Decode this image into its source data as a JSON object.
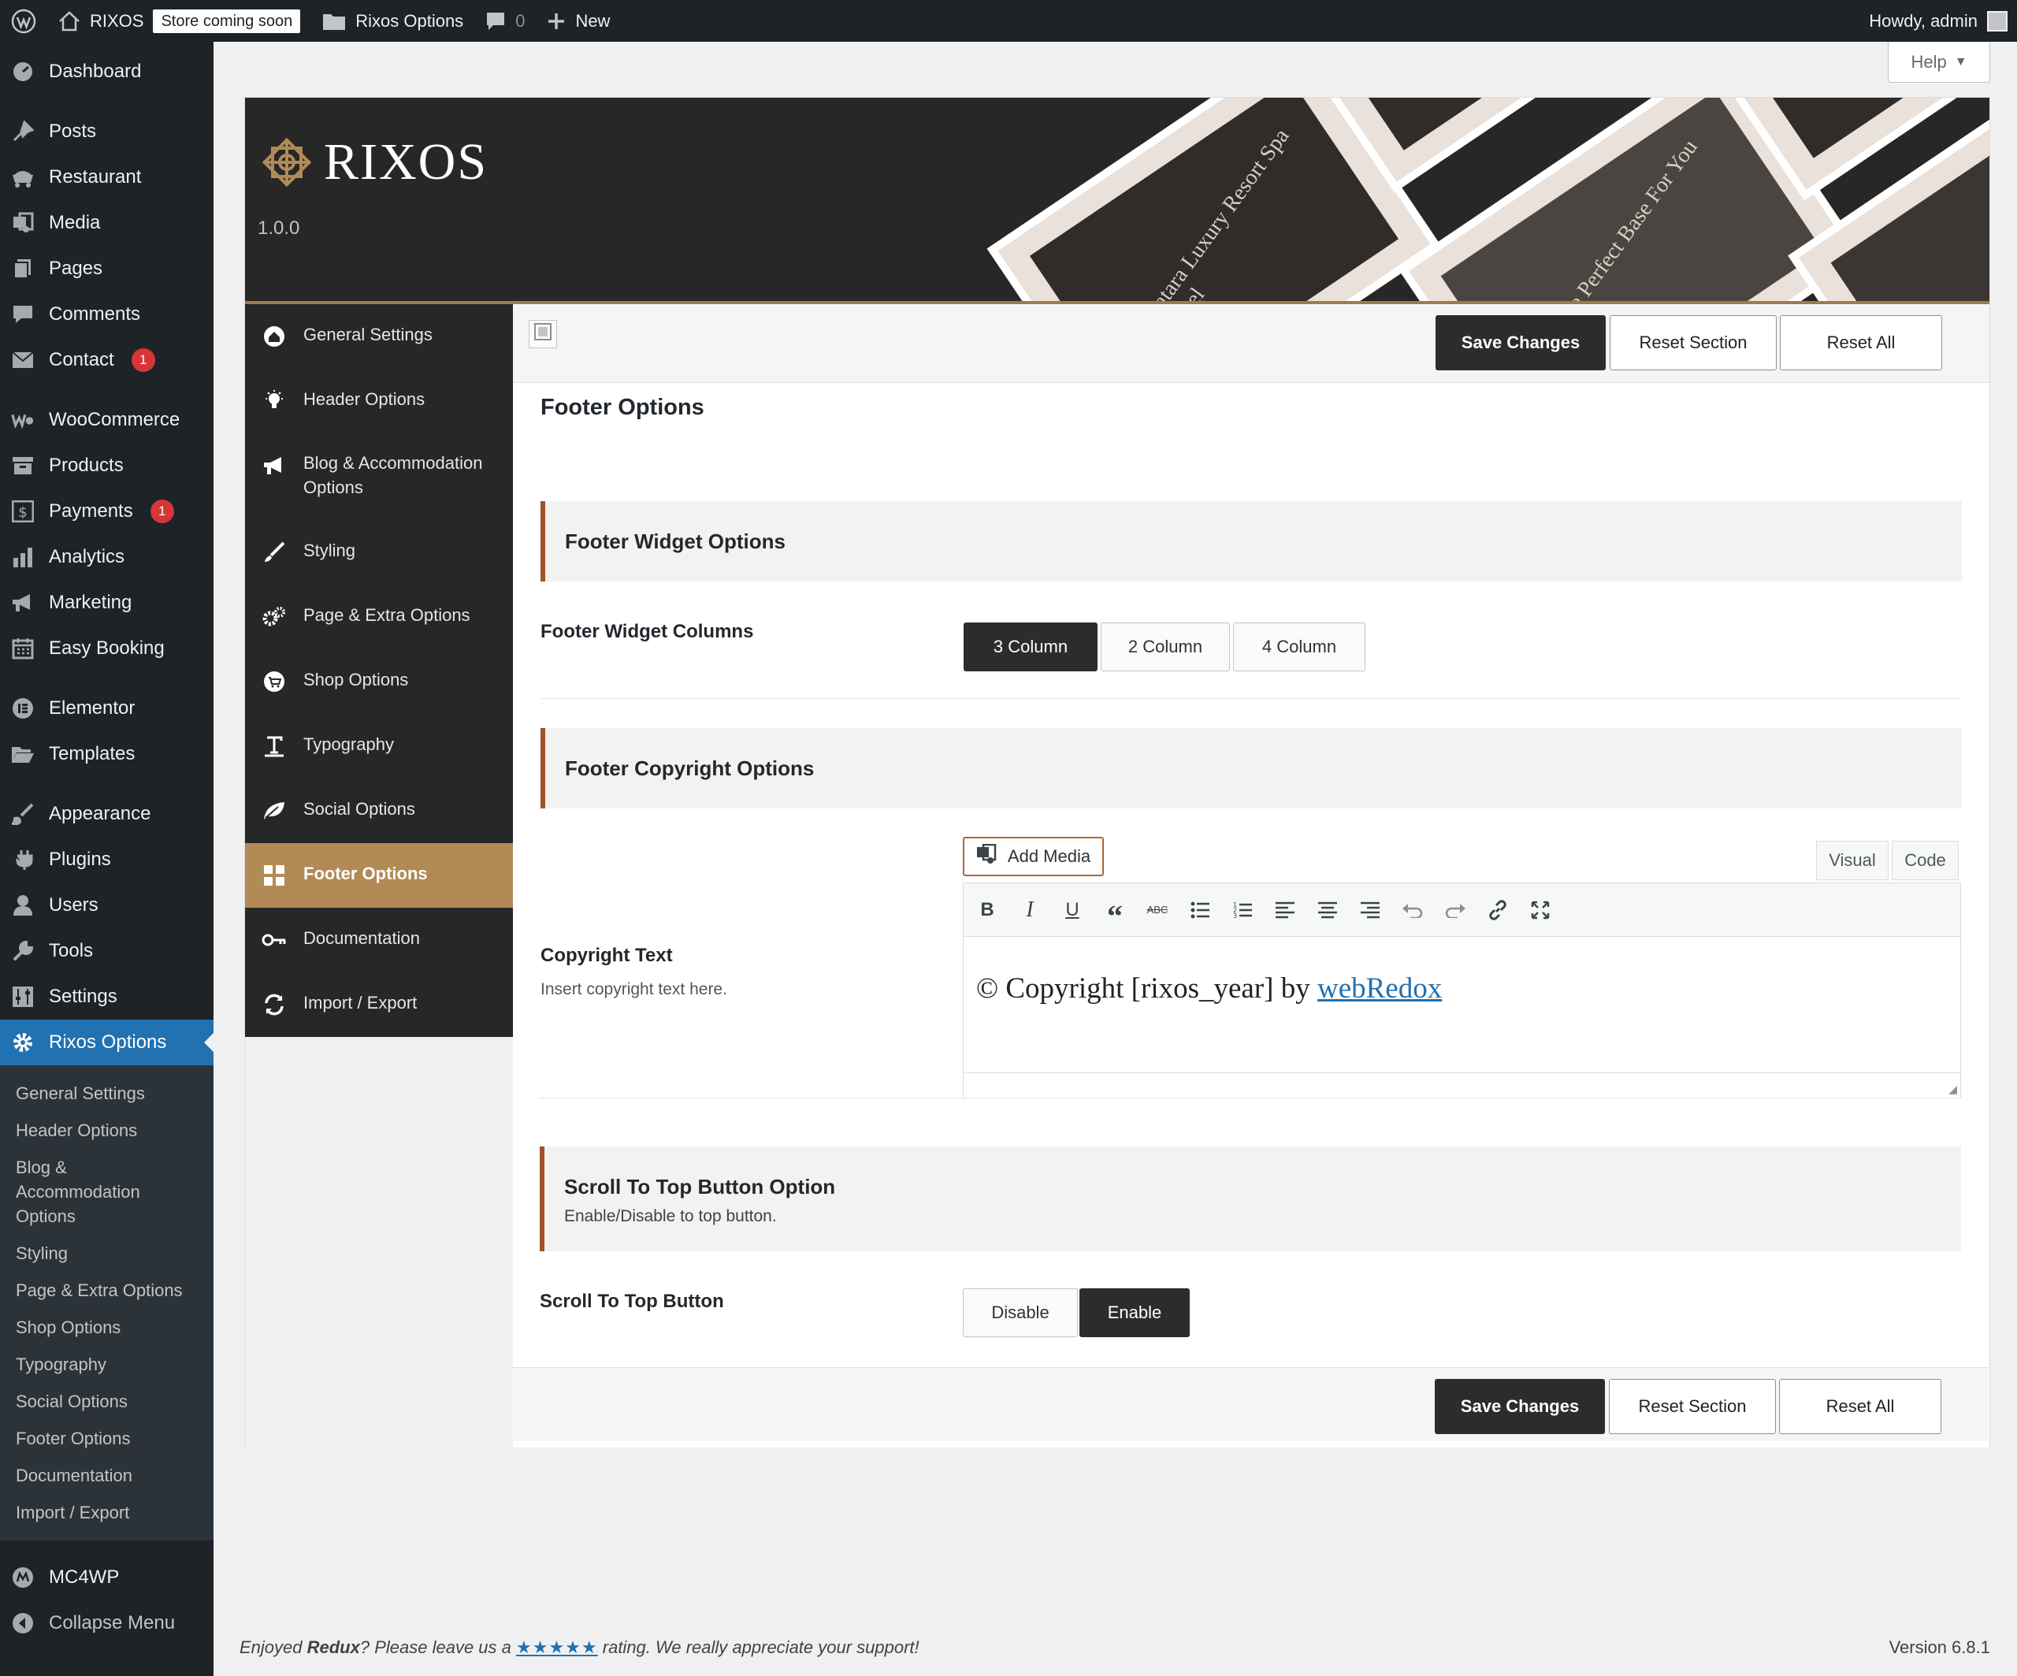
{
  "adminbar": {
    "site_name": "RIXOS",
    "store_badge": "Store coming soon",
    "options_link": "Rixos Options",
    "comments_count": "0",
    "new_label": "New",
    "howdy": "Howdy, admin"
  },
  "menu": {
    "dashboard": "Dashboard",
    "posts": "Posts",
    "restaurant": "Restaurant",
    "media": "Media",
    "pages": "Pages",
    "comments": "Comments",
    "contact": "Contact",
    "contact_badge": "1",
    "woocommerce": "WooCommerce",
    "products": "Products",
    "payments": "Payments",
    "payments_badge": "1",
    "analytics": "Analytics",
    "marketing": "Marketing",
    "easy_booking": "Easy Booking",
    "elementor": "Elementor",
    "templates": "Templates",
    "appearance": "Appearance",
    "plugins": "Plugins",
    "users": "Users",
    "tools": "Tools",
    "settings": "Settings",
    "rixos_options": "Rixos Options",
    "submenu": [
      "General Settings",
      "Header Options",
      "Blog & Accommodation Options",
      "Styling",
      "Page & Extra Options",
      "Shop Options",
      "Typography",
      "Social Options",
      "Footer Options",
      "Documentation",
      "Import / Export"
    ],
    "mc4wp": "MC4WP",
    "collapse": "Collapse Menu"
  },
  "help_label": "Help",
  "header": {
    "logo_text": "RIXOS",
    "version": "1.0.0",
    "promo_1": "Patara Luxury Resort Spa Hotel",
    "promo_2": "The Perfect Base For You"
  },
  "sections": [
    "General Settings",
    "Header Options",
    "Blog & Accommodation Options",
    "Styling",
    "Page & Extra Options",
    "Shop Options",
    "Typography",
    "Social Options",
    "Footer Options",
    "Documentation",
    "Import / Export"
  ],
  "actions": {
    "save": "Save Changes",
    "reset_section": "Reset Section",
    "reset_all": "Reset All"
  },
  "main": {
    "title": "Footer Options",
    "widget_group": "Footer Widget Options",
    "widget_columns_label": "Footer Widget Columns",
    "columns": [
      "3 Column",
      "2 Column",
      "4 Column"
    ],
    "columns_selected": "3 Column",
    "copyright_group": "Footer Copyright Options",
    "copyright_label": "Copyright Text",
    "copyright_desc": "Insert copyright text here.",
    "add_media": "Add Media",
    "tab_visual": "Visual",
    "tab_code": "Code",
    "copyright_text_prefix": "© Copyright [rixos_year] by ",
    "copyright_link": "webRedox",
    "scroll_group": "Scroll To Top Button Option",
    "scroll_group_sub": "Enable/Disable to top button.",
    "scroll_label": "Scroll To Top Button",
    "scroll_options": [
      "Disable",
      "Enable"
    ],
    "scroll_selected": "Enable"
  },
  "footer": {
    "thanks_1": "Enjoyed ",
    "thanks_brand": "Redux",
    "thanks_2": "? Please leave us a ",
    "stars": "★★★★★",
    "thanks_3": " rating. We really appreciate your support!",
    "version": "Version 6.8.1"
  }
}
